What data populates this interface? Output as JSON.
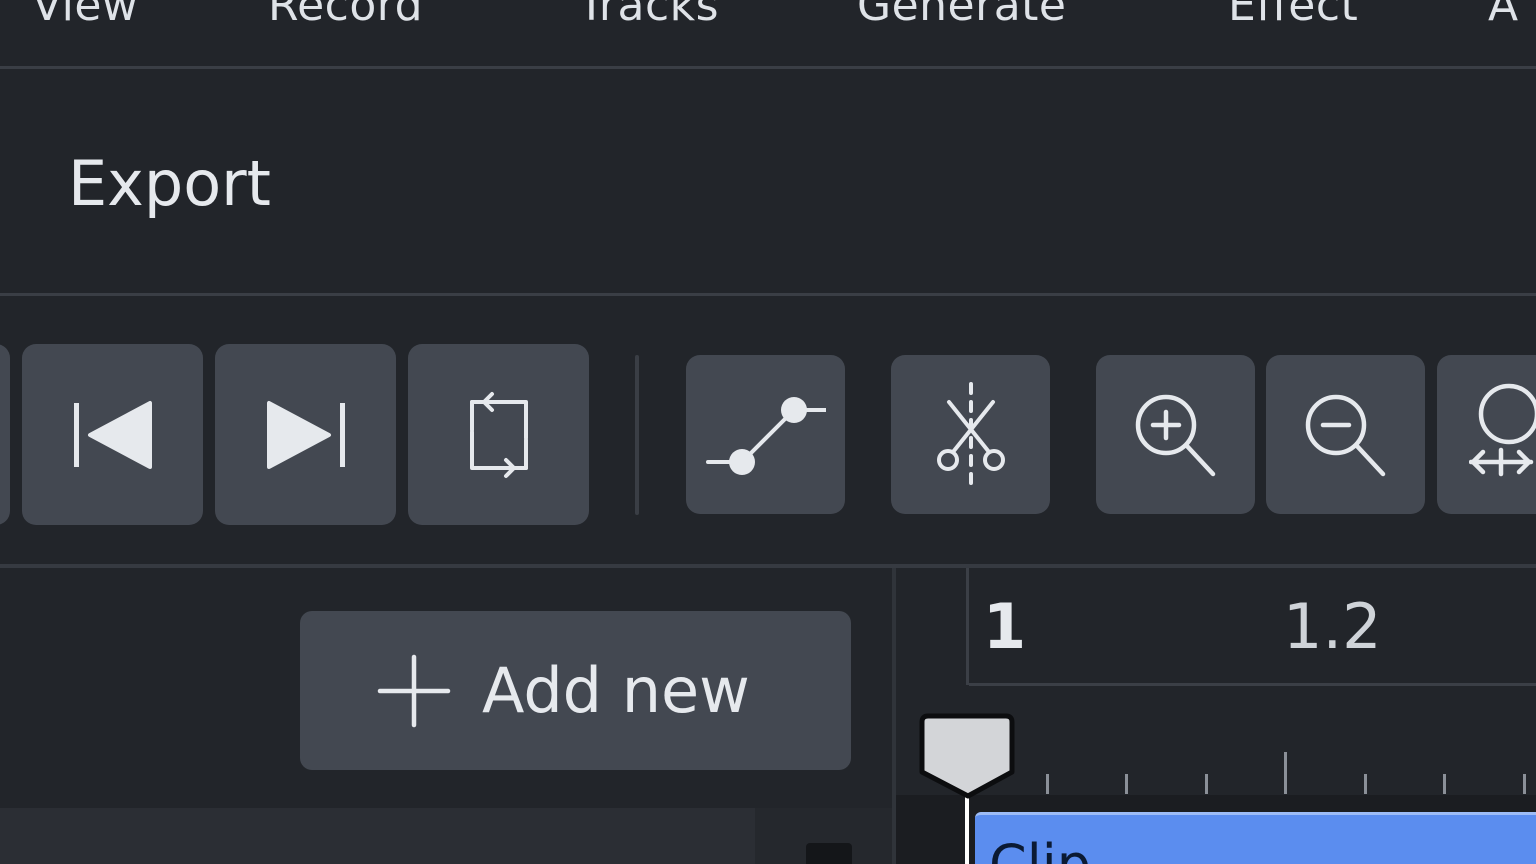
{
  "menu": {
    "items": [
      "View",
      "Record",
      "Tracks",
      "Generate",
      "Effect",
      "A"
    ]
  },
  "export_row": {
    "label": "Export"
  },
  "toolbar": {
    "buttons": [
      {
        "name": "skip-to-start",
        "icon": "skip-back-icon"
      },
      {
        "name": "skip-to-end",
        "icon": "skip-forward-icon"
      },
      {
        "name": "loop",
        "icon": "loop-icon"
      },
      {
        "name": "envelope-tool",
        "icon": "envelope-icon"
      },
      {
        "name": "split-tool",
        "icon": "scissors-split-icon"
      },
      {
        "name": "zoom-in",
        "icon": "zoom-in-icon"
      },
      {
        "name": "zoom-out",
        "icon": "zoom-out-icon"
      },
      {
        "name": "zoom-fit",
        "icon": "zoom-fit-icon"
      }
    ]
  },
  "tracks": {
    "add_new_label": "Add new"
  },
  "ruler": {
    "labels": [
      "1",
      "1.2"
    ]
  },
  "clip": {
    "label": "Clip"
  },
  "colors": {
    "background": "#22252a",
    "button": "#434851",
    "clip": "#5b8def",
    "text": "#e6e9ed"
  }
}
